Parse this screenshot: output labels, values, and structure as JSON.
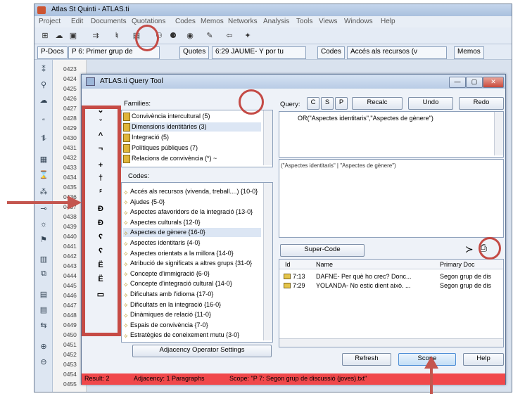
{
  "app": {
    "title": "Atlas St Quinti - ATLAS.ti",
    "menu": [
      "Project",
      "Edit",
      "Documents",
      "Quotations",
      "Codes",
      "Memos",
      "Networks",
      "Analysis",
      "Tools",
      "Views",
      "Windows",
      "Help"
    ]
  },
  "toolbar2": {
    "pdocs": "P-Docs",
    "pdoc_value": "P 6: Primer grup de",
    "quotes": "Quotes",
    "quote_value": "6:29 JAUME- Y por tu",
    "codes": "Codes",
    "code_value": "Accés als recursos (v",
    "memos": "Memos"
  },
  "line_numbers": [
    "0423",
    "0424",
    "0425",
    "0426",
    "0427",
    "0428",
    "0429",
    "0430",
    "0431",
    "0432",
    "0433",
    "0434",
    "0435",
    "0436",
    "0437",
    "0438",
    "0439",
    "0440",
    "0441",
    "0442",
    "0443",
    "0444",
    "0445",
    "0446",
    "0447",
    "0448",
    "0449",
    "0450",
    "0451",
    "0452",
    "0453",
    "0454",
    "0455"
  ],
  "dialog": {
    "title": "ATLAS.ti Query Tool",
    "families_label": "Families:",
    "families": [
      "Convivència intercultural (5)",
      "Dimensions identitàries (3)",
      "Integració (5)",
      "Polítiques públiques (7)",
      "Relacions de convivència (*) ~"
    ],
    "codes_label": "Codes:",
    "codes": [
      "Accés als recursos (vivenda, treball....) {10-0}",
      "Ajudes {5-0}",
      "Aspectes afavoridors de la integració {13-0}",
      "Aspectes culturals {12-0}",
      "Aspectes de gènere {16-0}",
      "Aspectes identitaris {4-0}",
      "Aspectes orientats a la millora {14-0}",
      "Atribució de significats a altres grups {31-0}",
      "Concepte d'immigració {6-0}",
      "Concepte d'integració cultural {14-0}",
      "Dificultats amb l'idioma {17-0}",
      "Dificultats en la integració {16-0}",
      "Dinàmiques de relació {11-0}",
      "Espais de convivència {7-0}",
      "Estratègies de coneixement mutu {3-0}"
    ],
    "adjacency_button": "Adjacency Operator Settings",
    "query_label": "Query:",
    "query_buttons": [
      "C",
      "S",
      "P"
    ],
    "recalc": "Recalc",
    "undo": "Undo",
    "redo": "Redo",
    "query_text": "OR(\"Aspectes identitaris\",\"Aspectes de gènere\")",
    "expression_text": "(\"Aspectes identitaris\" | \"Aspectes de gènere\")",
    "supercode": "Super-Code",
    "results_headers": [
      "Id",
      "Name",
      "Primary Doc"
    ],
    "results": [
      {
        "id": "7:13",
        "name": "DAFNE- Per què ho crec? Donc...",
        "doc": "Segon grup de dis"
      },
      {
        "id": "7:29",
        "name": "YOLANDA- No estic dient això. ...",
        "doc": "Segon grup de dis"
      }
    ],
    "refresh": "Refresh",
    "scope": "Scope",
    "help": "Help",
    "status": {
      "results": "Result: 2",
      "adjacency": "Adjacency: 1 Paragraphs",
      "scope": "Scope: \"P 7: Segon grup de discussió (joves).txt\""
    }
  },
  "operators": [
    {
      "icon": "tilde-down-icon",
      "glyph": "⌄"
    },
    {
      "icon": "down-caret-icon",
      "glyph": "ˇ"
    },
    {
      "icon": "up-caret-icon",
      "glyph": "^"
    },
    {
      "icon": "not-icon",
      "glyph": "¬"
    },
    {
      "icon": "plus-icon",
      "glyph": "+"
    },
    {
      "icon": "dagger-icon",
      "glyph": "†"
    },
    {
      "icon": "tree-icon",
      "glyph": "⸗"
    },
    {
      "icon": "d-icon-1",
      "glyph": "Đ"
    },
    {
      "icon": "d-icon-2",
      "glyph": "Đ"
    },
    {
      "icon": "s-icon-1",
      "glyph": "ʕ"
    },
    {
      "icon": "s-icon-2",
      "glyph": "ʕ"
    },
    {
      "icon": "e-icon-1",
      "glyph": "Ë"
    },
    {
      "icon": "e-icon-2",
      "glyph": "Ë"
    },
    {
      "icon": "box-icon",
      "glyph": "▭"
    }
  ],
  "colors": {
    "annotation": "#c64b45",
    "status_bar": "#f0484b",
    "selection": "#dce6f4"
  }
}
